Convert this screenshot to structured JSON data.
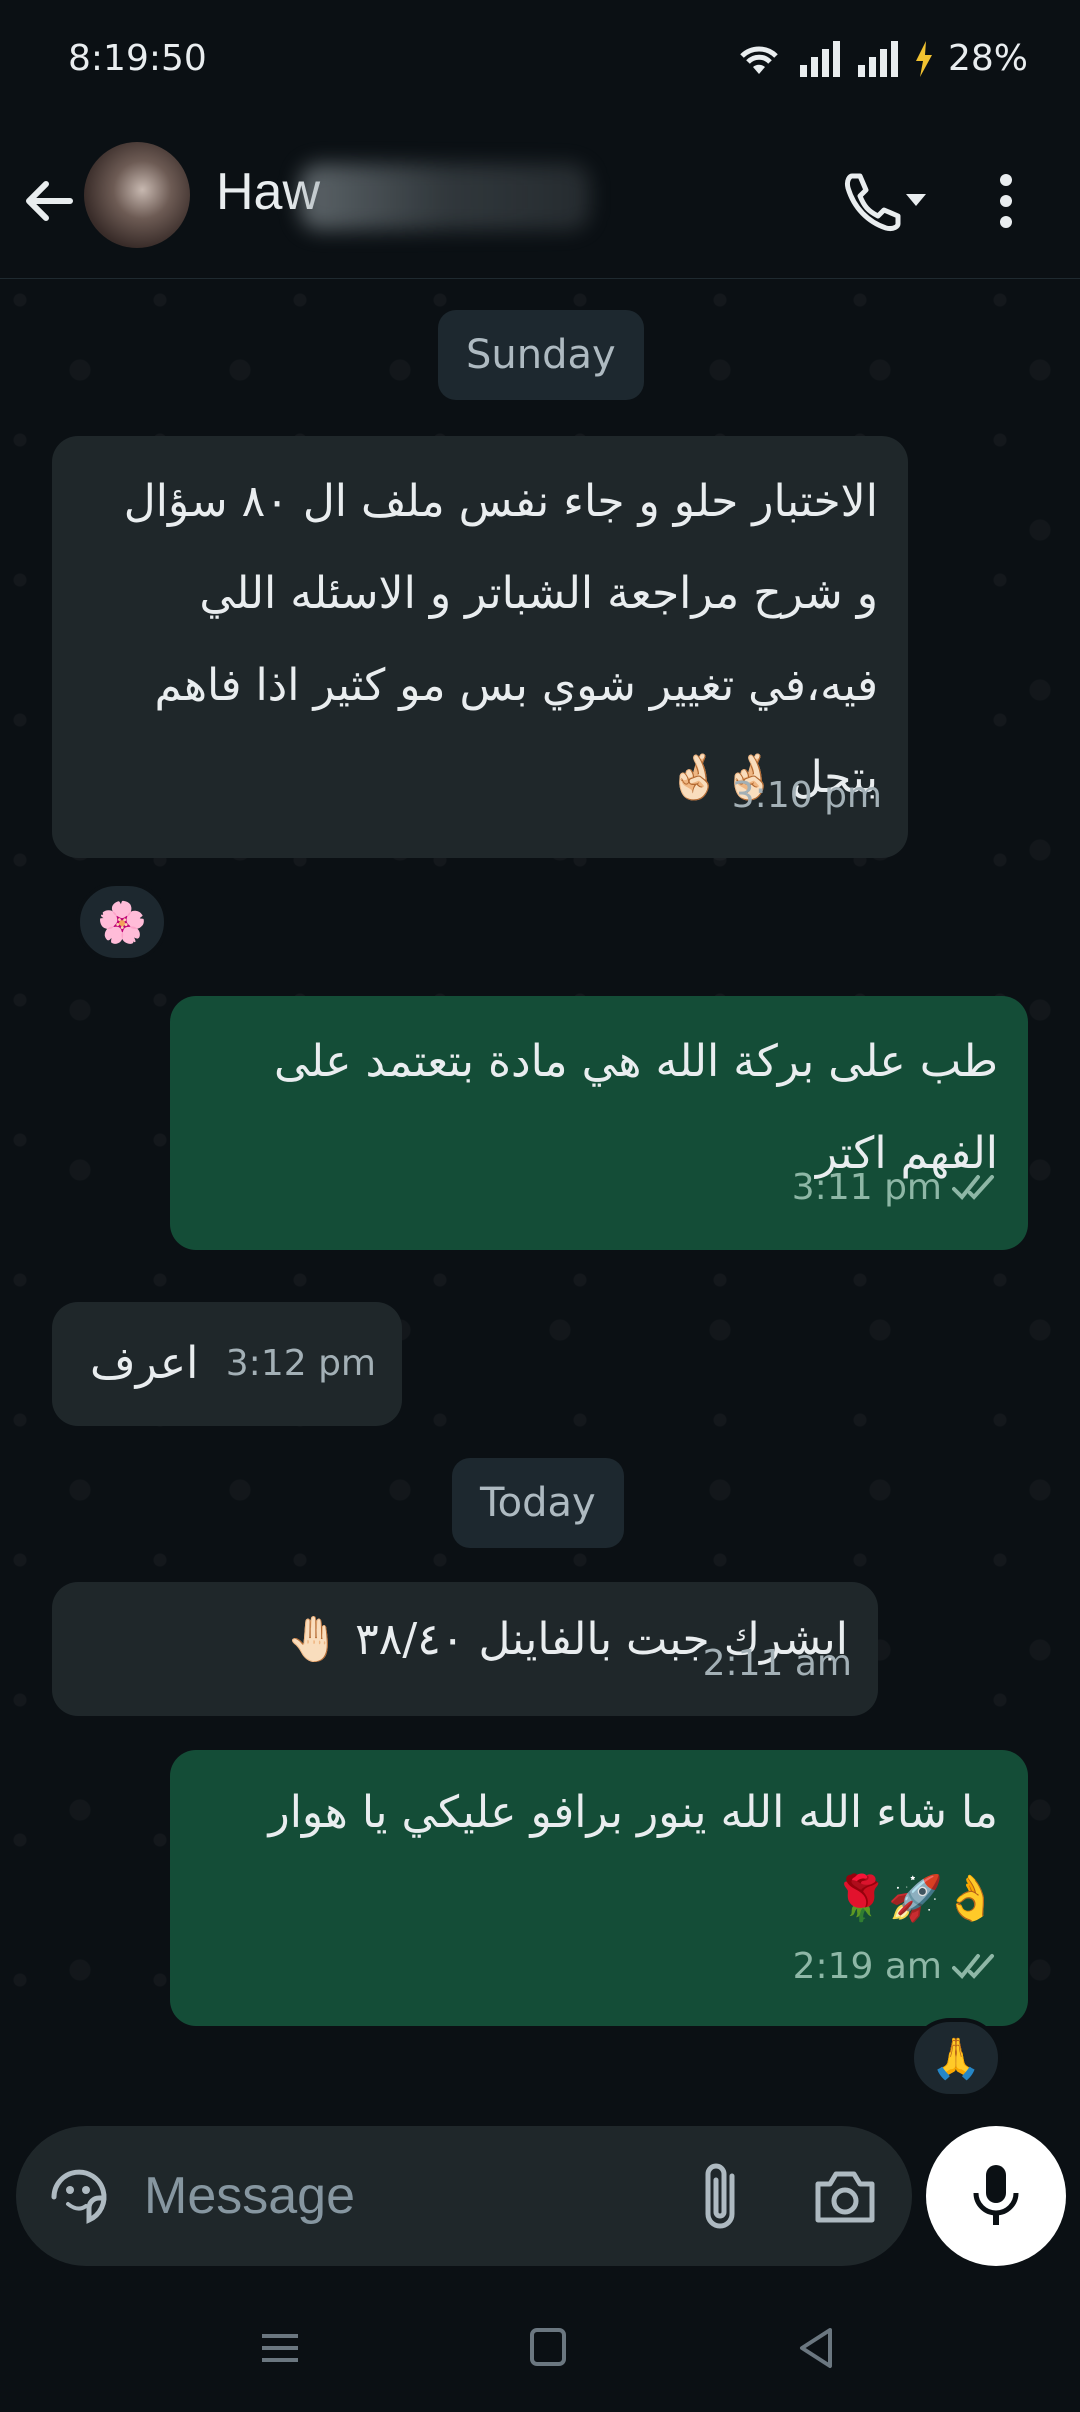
{
  "status_bar": {
    "time": "8:19:50",
    "battery": "28%"
  },
  "header": {
    "contact_name": "Haw"
  },
  "chat": {
    "date_sunday": "Sunday",
    "date_today": "Today",
    "messages": [
      {
        "dir": "in",
        "text": "الاختبار حلو و جاء نفس ملف ال ٨٠ سؤال\nو شرح مراجعة الشباتر و الاسئله اللي\nفيه،في تغيير شوي بس مو كثير اذا فاهم\nبتحل 🤞🏻🤞🏻",
        "time": "3:10 pm",
        "reaction": "🌸"
      },
      {
        "dir": "out",
        "text": "طب على بركة الله هي مادة بتعتمد على\nالفهم اكتر",
        "time": "3:11 pm"
      },
      {
        "dir": "in",
        "text": "اعرف",
        "time": "3:12 pm"
      },
      {
        "dir": "in",
        "text": "ابشرك جبت بالفاينل ٣٨/٤٠ 🤚🏻",
        "time": "2:11 am"
      },
      {
        "dir": "out",
        "text": "ما شاء الله الله ينور برافو عليكي يا هوار\n👌🚀🌹",
        "time": "2:19 am",
        "reaction": "🙏"
      }
    ]
  },
  "input": {
    "placeholder": "Message"
  },
  "colors": {
    "incoming": "#1f272a",
    "outgoing": "#144d37",
    "background": "#0b1014",
    "accent": "#25d366"
  },
  "icons": [
    "wifi-icon",
    "signal-icon",
    "battery-icon",
    "back-arrow-icon",
    "phone-icon",
    "more-vert-icon",
    "sticker-icon",
    "attach-icon",
    "camera-icon",
    "mic-icon",
    "double-check-icon"
  ]
}
